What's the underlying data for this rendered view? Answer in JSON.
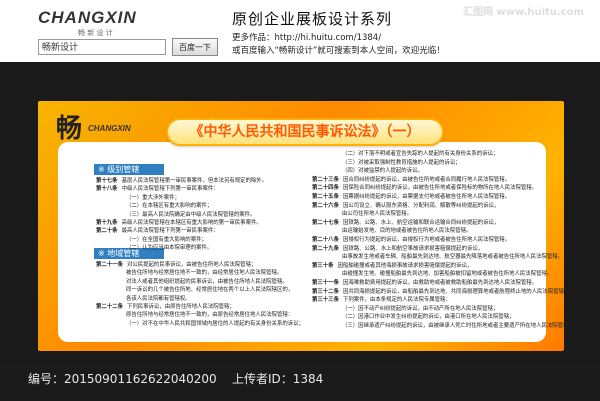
{
  "header": {
    "brand": "CHANGXIN",
    "brand_sub": "畅 新 设 计",
    "search_value": "畅新设计",
    "search_button": "百度一下",
    "series_title": "原创企业展板设计系列",
    "more_works": "更多作品：http://hi.huitu.com/1384/",
    "search_hint": "或百度输入“畅新设计”就可搜索到本人空间，欢迎光临！",
    "watermark": "汇图网 www.huitu.com"
  },
  "board": {
    "logo_ink": "畅",
    "logo_text": "CHANGXIN",
    "title": "《中华人民共和国民事诉讼法》（一）",
    "sections": [
      {
        "label": "※ 级别管辖"
      },
      {
        "label": "※ 地域管辖"
      }
    ],
    "left_articles": [
      {
        "num": "第十七条",
        "text": "基层人民法院管辖第一审民事案件，但本法另有规定的除外。"
      },
      {
        "num": "第十八条",
        "text": "中级人民法院管辖下列第一审民事案件："
      },
      {
        "num": "",
        "text": "（一）重大涉外案件；"
      },
      {
        "num": "",
        "text": "（二）在本辖区有重大影响的案件；"
      },
      {
        "num": "",
        "text": "（三）最高人民法院确定由中级人民法院管辖的案件。"
      },
      {
        "num": "第十九条",
        "text": "高级人民法院管辖在本辖区有重大影响的第一审民事案件。"
      },
      {
        "num": "第二十条",
        "text": "最高人民法院管辖下列第一审民事案件："
      },
      {
        "num": "",
        "text": "（一）在全国有重大影响的案件；"
      },
      {
        "num": "",
        "text": "（二）认为应当由本院审理的案件。"
      },
      {
        "num": "第二十一条",
        "text": "对公民提起的民事诉讼，由被告住所地人民法院管辖；"
      },
      {
        "num": "",
        "text": "被告住所地与经常居住地不一致的，由经常居住地人民法院管辖。"
      },
      {
        "num": "",
        "text": "对法人或者其他组织提起的民事诉讼，由被告住所地人民法院管辖。"
      },
      {
        "num": "",
        "text": "同一诉讼的几个被告住所地、经常居住地在两个以上人民法院辖区的，"
      },
      {
        "num": "",
        "text": "各该人民法院都有管辖权。"
      },
      {
        "num": "第二十二条",
        "text": "下列民事诉讼，由原告住所地人民法院管辖；"
      },
      {
        "num": "",
        "text": "原告住所地与经常居住地不一致的，由原告经常居住地人民法院管辖："
      },
      {
        "num": "",
        "text": "（一）对不在中华人民共和国领域内居住的人提起的有关身份关系的诉讼；"
      }
    ],
    "right_articles": [
      {
        "num": "",
        "text": "（二）对下落不明或者宣告失踪的人提起的有关身份关系的诉讼；"
      },
      {
        "num": "",
        "text": "（三）对被采取强制性教育措施的人提起的诉讼；"
      },
      {
        "num": "",
        "text": "（四）对被监禁的人提起的诉讼。"
      },
      {
        "num": "第二十三条",
        "text": "因合同纠纷提起的诉讼，由被告住所地或者合同履行地人民法院管辖。"
      },
      {
        "num": "第二十四条",
        "text": "因保险合同纠纷提起的诉讼，由被告住所地或者保险标的物所在地人民法院管辖。"
      },
      {
        "num": "第二十五条",
        "text": "因票据纠纷提起的诉讼，由票据支付地或者被告住所地人民法院管辖。"
      },
      {
        "num": "第二十六条",
        "text": "因公司设立、确认股东资格、分配利润、解散等纠纷提起的诉讼，"
      },
      {
        "num": "",
        "text": "由公司住所地人民法院管辖。"
      },
      {
        "num": "第二十七条",
        "text": "因铁路、公路、水上、航空运输和联合运输合同纠纷提起的诉讼，"
      },
      {
        "num": "",
        "text": "由运输始发地、目的地或者被告住所地人民法院管辖。"
      },
      {
        "num": "第二十八条",
        "text": "因侵权行为提起的诉讼，由侵权行为地或者被告住所地人民法院管辖。"
      },
      {
        "num": "第二十九条",
        "text": "因铁路、公路、水上和航空事故请求损害赔偿提起的诉讼，"
      },
      {
        "num": "",
        "text": "由事故发生地或者车辆、船舶最先到达地、航空器最先降落地或者被告住所地人民法院管辖。"
      },
      {
        "num": "第三十条",
        "text": "因船舶碰撞或者其他海损事故请求损害赔偿提起的诉讼，"
      },
      {
        "num": "",
        "text": "由碰撞发生地、碰撞船舶最先到达地、加害船舶被扣留地或者被告住所地人民法院管辖。"
      },
      {
        "num": "第三十一条",
        "text": "因海难救助费用提起的诉讼，由救助地或者被救助船舶最先到达地人民法院管辖。"
      },
      {
        "num": "第三十二条",
        "text": "因共同海损提起的诉讼，由船舶最先到达地、共同海损理算地或者航程终止地的人民法院管辖。"
      },
      {
        "num": "第三十三条",
        "text": "下列案件，由本条规定的人民法院专属管辖："
      },
      {
        "num": "",
        "text": "（一）因不动产纠纷提起的诉讼，由不动产所在地人民法院管辖；"
      },
      {
        "num": "",
        "text": "（二）因港口作业中发生纠纷提起的诉讼，由港口所在地人民法院管辖；"
      },
      {
        "num": "",
        "text": "（三）因继承遗产纠纷提起的诉讼，由被继承人死亡时住所地或者主要遗产所在地人民法院管辖。"
      }
    ]
  },
  "footer": {
    "id_text": "编号：20150901162622040200",
    "uploader_text": "上传者ID：1384"
  }
}
